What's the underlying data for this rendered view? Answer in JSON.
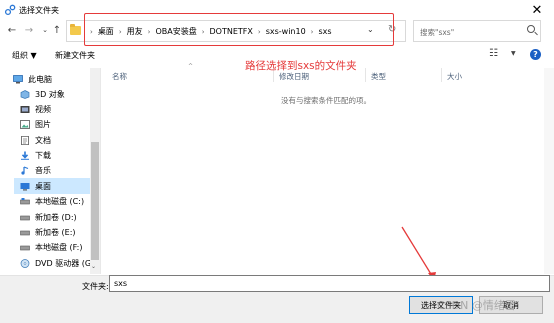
{
  "window": {
    "title": "选择文件夹",
    "close_glyph": "✕"
  },
  "nav": {
    "back_glyph": "←",
    "forward_glyph": "→",
    "dropdown_glyph": "⌄",
    "up_glyph": "↑",
    "breadcrumbs": [
      "桌面",
      "用友",
      "OBA安装盘",
      "DOTNETFX",
      "sxs-win10",
      "sxs"
    ],
    "breadcrumb_sep": "›",
    "address_dropdown_glyph": "⌄",
    "refresh_glyph": "↻",
    "search_placeholder": "搜索\"sxs\""
  },
  "toolbar": {
    "organize_label": "组织 ▼",
    "new_folder_label": "新建文件夹",
    "view_glyph": "☷",
    "view_arrow": "▼",
    "help_glyph": "?"
  },
  "sidebar": {
    "items": [
      {
        "label": "此电脑",
        "icon": "computer-icon"
      },
      {
        "label": "3D 对象",
        "icon": "cube-icon"
      },
      {
        "label": "视频",
        "icon": "video-icon"
      },
      {
        "label": "图片",
        "icon": "picture-icon"
      },
      {
        "label": "文档",
        "icon": "document-icon"
      },
      {
        "label": "下载",
        "icon": "download-icon"
      },
      {
        "label": "音乐",
        "icon": "music-icon"
      },
      {
        "label": "桌面",
        "icon": "desktop-icon"
      },
      {
        "label": "本地磁盘 (C:)",
        "icon": "drive-icon"
      },
      {
        "label": "新加卷 (D:)",
        "icon": "drive-icon"
      },
      {
        "label": "新加卷 (E:)",
        "icon": "drive-icon"
      },
      {
        "label": "本地磁盘 (F:)",
        "icon": "drive-icon"
      },
      {
        "label": "DVD 驱动器 (G:",
        "icon": "dvd-icon"
      }
    ],
    "selected_index": 7
  },
  "content": {
    "columns": [
      "名称",
      "修改日期",
      "类型",
      "大小"
    ],
    "empty_message": "没有与搜索条件匹配的项。",
    "annotation": "路径选择到sxs的文件夹",
    "annotation_color": "#e53a3a"
  },
  "footer": {
    "folder_label": "文件夹:",
    "folder_value": "sxs",
    "select_button": "选择文件夹",
    "cancel_button": "取消",
    "watermark": "CSDN @情绪雪"
  },
  "colors": {
    "accent": "#0078d7",
    "selected_bg": "#cce8ff",
    "annotation": "#e53a3a"
  }
}
